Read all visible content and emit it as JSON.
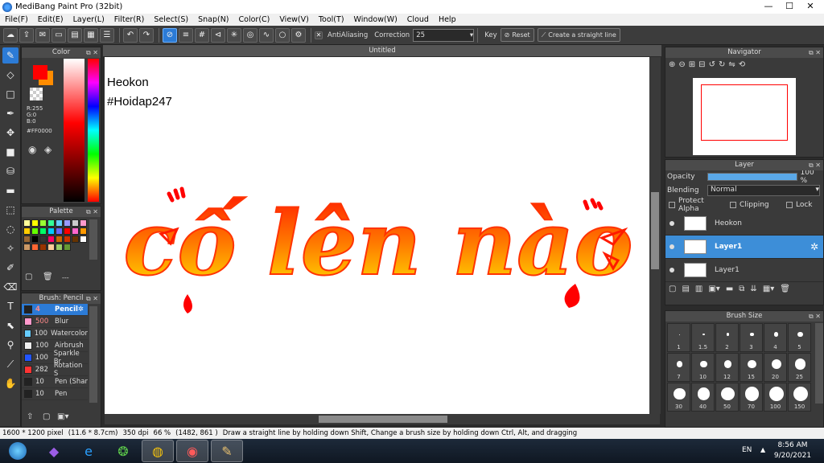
{
  "window": {
    "title": "MediBang Paint Pro (32bit)",
    "minimize": "—",
    "maximize": "☐",
    "close": "✕"
  },
  "menu": [
    "File(F)",
    "Edit(E)",
    "Layer(L)",
    "Filter(R)",
    "Select(S)",
    "Snap(N)",
    "Color(C)",
    "View(V)",
    "Tool(T)",
    "Window(W)",
    "Cloud",
    "Help"
  ],
  "toolbar": {
    "antialiasing_label": "AntiAliasing",
    "correction_label": "Correction",
    "correction_value": "25",
    "key_label": "Key",
    "reset_label": "Reset",
    "straight_line_label": "Create a straight line"
  },
  "color": {
    "title": "Color",
    "r": "R:255",
    "g": "G:0",
    "b": "B:0",
    "hex_label": "#FF0000",
    "primary": "#FF0000",
    "secondary": "#FF8C00"
  },
  "palette": {
    "title": "Palette",
    "colors": [
      "#ffff99",
      "#ffff00",
      "#99ff33",
      "#33ff99",
      "#66ccff",
      "#9999ff",
      "#cccccc",
      "#ff99cc",
      "#ffcc00",
      "#66ff00",
      "#00ff66",
      "#00ccff",
      "#6666ff",
      "#ff0000",
      "#ff66cc",
      "#ff9900",
      "#996633",
      "#000000",
      "#333333",
      "#ff0066",
      "#cc6600",
      "#cc3300",
      "#663300",
      "#ffffff",
      "#cc9966",
      "#ff6633",
      "#993300",
      "#ffcc99",
      "#99cc66",
      "#669933"
    ],
    "ellipsis": "---"
  },
  "brush": {
    "title": "Brush: Pencil",
    "items": [
      {
        "size": "4",
        "name": "Pencil",
        "color": "#222222"
      },
      {
        "size": "500",
        "name": "Blur",
        "color": "#ff99cc"
      },
      {
        "size": "100",
        "name": "Watercolor",
        "color": "#66ccff"
      },
      {
        "size": "100",
        "name": "Airbrush",
        "color": "#eeeeee"
      },
      {
        "size": "100",
        "name": "Sparkle Br",
        "color": "#2255ff"
      },
      {
        "size": "282",
        "name": "Rotation S",
        "color": "#ff3333"
      },
      {
        "size": "10",
        "name": "Pen (Shar",
        "color": "#222222"
      },
      {
        "size": "10",
        "name": "Pen",
        "color": "#222222"
      }
    ]
  },
  "canvas": {
    "tab_title": "Untitled",
    "text_line1": "Heokon",
    "text_line2": "#Hoidap247",
    "artwork": "cố lên nào"
  },
  "navigator": {
    "title": "Navigator"
  },
  "layer": {
    "title": "Layer",
    "opacity_label": "Opacity",
    "opacity_value": "100 %",
    "opacity_fraction": 1.0,
    "blending_label": "Blending",
    "blending_value": "Normal",
    "protect_alpha": "Protect Alpha",
    "clipping": "Clipping",
    "lock": "Lock",
    "layers": [
      {
        "name": "Heokon",
        "selected": false
      },
      {
        "name": "Layer1",
        "selected": true
      },
      {
        "name": "Layer1",
        "selected": false
      }
    ]
  },
  "brush_size": {
    "title": "Brush Size",
    "sizes": [
      "1",
      "1.5",
      "2",
      "3",
      "4",
      "5",
      "7",
      "10",
      "12",
      "15",
      "20",
      "25",
      "30",
      "40",
      "50",
      "70",
      "100",
      "150"
    ]
  },
  "status": {
    "size": "1600 * 1200 pixel",
    "physical": "(11.6 * 8.7cm)",
    "dpi": "350 dpi",
    "zoom": "66 %",
    "coords": "(1482, 861 )",
    "hint": "Draw a straight line by holding down Shift, Change a brush size by holding down Ctrl, Alt, and dragging"
  },
  "taskbar": {
    "lang": "EN",
    "time": "8:56 AM",
    "date": "9/20/2021"
  }
}
